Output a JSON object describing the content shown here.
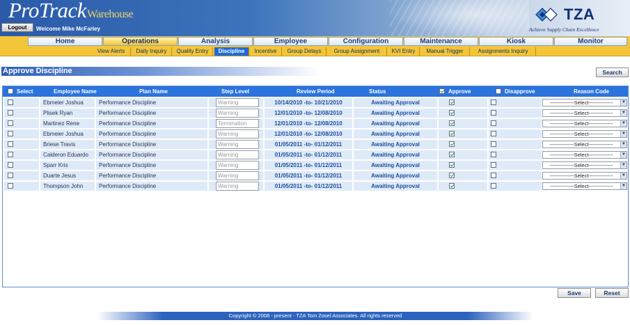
{
  "header": {
    "logo_main": "ProTrack",
    "logo_sub": "Warehouse",
    "logout_label": "Logout",
    "welcome_text": "Welcome Mike McFarley",
    "brand_name": "TZA",
    "brand_tagline": "Achieve Supply Chain Excellence"
  },
  "main_nav": [
    "Home",
    "Operations",
    "Analysis",
    "Employee",
    "Configuration",
    "Maintenance",
    "Kiosk",
    "Monitor"
  ],
  "main_nav_active": "Operations",
  "sub_nav": [
    "View Alerts",
    "Daily Inquiry",
    "Quality Entry",
    "Discipline",
    "Incentive",
    "Group Delays",
    "Group Assignment",
    "KVI Entry",
    "Manual Trigger",
    "Assignments Inquiry"
  ],
  "sub_nav_active": "Discipline",
  "page": {
    "title": "Approve Discipline",
    "search_label": "Search",
    "save_label": "Save",
    "reset_label": "Reset"
  },
  "grid": {
    "headers": {
      "select": "Select",
      "employee_name": "Employee Name",
      "plan_name": "Plan Name",
      "step_level": "Step Level",
      "review_period": "Review Period",
      "status": "Status",
      "approve": "Approve",
      "disapprove": "Disapprove",
      "reason_code": "Reason Code"
    },
    "header_approve_checked": true,
    "rows": [
      {
        "employee": "Ebmeier Joshua",
        "plan": "Performance Discipline",
        "step": "Warning",
        "period": "10/14/2010 -to- 10/21/2010",
        "status": "Awaiting Approval",
        "approve": true,
        "disapprove": false,
        "reason": "--------------Select--------------"
      },
      {
        "employee": "Plisek Ryan",
        "plan": "Performance Discipline",
        "step": "Warning",
        "period": "12/01/2010 -to- 12/08/2010",
        "status": "Awaiting Approval",
        "approve": true,
        "disapprove": false,
        "reason": "--------------Select--------------"
      },
      {
        "employee": "Martinez Rene",
        "plan": "Performance Discipline",
        "step": "Termination",
        "period": "12/01/2010 -to- 12/08/2010",
        "status": "Awaiting Approval",
        "approve": true,
        "disapprove": false,
        "reason": "--------------Select--------------"
      },
      {
        "employee": "Ebmeier Joshua",
        "plan": "Performance Discipline",
        "step": "Warning",
        "period": "12/01/2010 -to- 12/08/2010",
        "status": "Awaiting Approval",
        "approve": true,
        "disapprove": false,
        "reason": "--------------Select--------------"
      },
      {
        "employee": "Briese Travis",
        "plan": "Performance Discipline",
        "step": "Warning",
        "period": "01/05/2011 -to- 01/12/2011",
        "status": "Awaiting Approval",
        "approve": true,
        "disapprove": false,
        "reason": "--------------Select--------------"
      },
      {
        "employee": "Calderon Eduardo",
        "plan": "Performance Discipline",
        "step": "Warning",
        "period": "01/05/2011 -to- 01/12/2011",
        "status": "Awaiting Approval",
        "approve": true,
        "disapprove": false,
        "reason": "--------------Select--------------"
      },
      {
        "employee": "Sparr Kris",
        "plan": "Performance Discipline",
        "step": "Warning",
        "period": "01/05/2011 -to- 01/12/2011",
        "status": "Awaiting Approval",
        "approve": true,
        "disapprove": false,
        "reason": "--------------Select--------------"
      },
      {
        "employee": "Duarte Jesus",
        "plan": "Performance Discipline",
        "step": "Warning",
        "period": "01/05/2011 -to- 01/12/2011",
        "status": "Awaiting Approval",
        "approve": true,
        "disapprove": false,
        "reason": "--------------Select--------------"
      },
      {
        "employee": "Thompson John",
        "plan": "Performance Discipline",
        "step": "Warning",
        "period": "01/05/2011 -to- 01/12/2011",
        "status": "Awaiting Approval",
        "approve": true,
        "disapprove": false,
        "reason": "--------------Select--------------"
      }
    ]
  },
  "footer": {
    "copyright": "Copyright © 2008 - present - TZA Tom Zosel Associates. All rights reserved"
  },
  "colors": {
    "nav_gold": "#f3c63a",
    "header_blue": "#2b73dd",
    "row_fill": "#dfeaf8",
    "active_sub": "#1f6ad8"
  }
}
